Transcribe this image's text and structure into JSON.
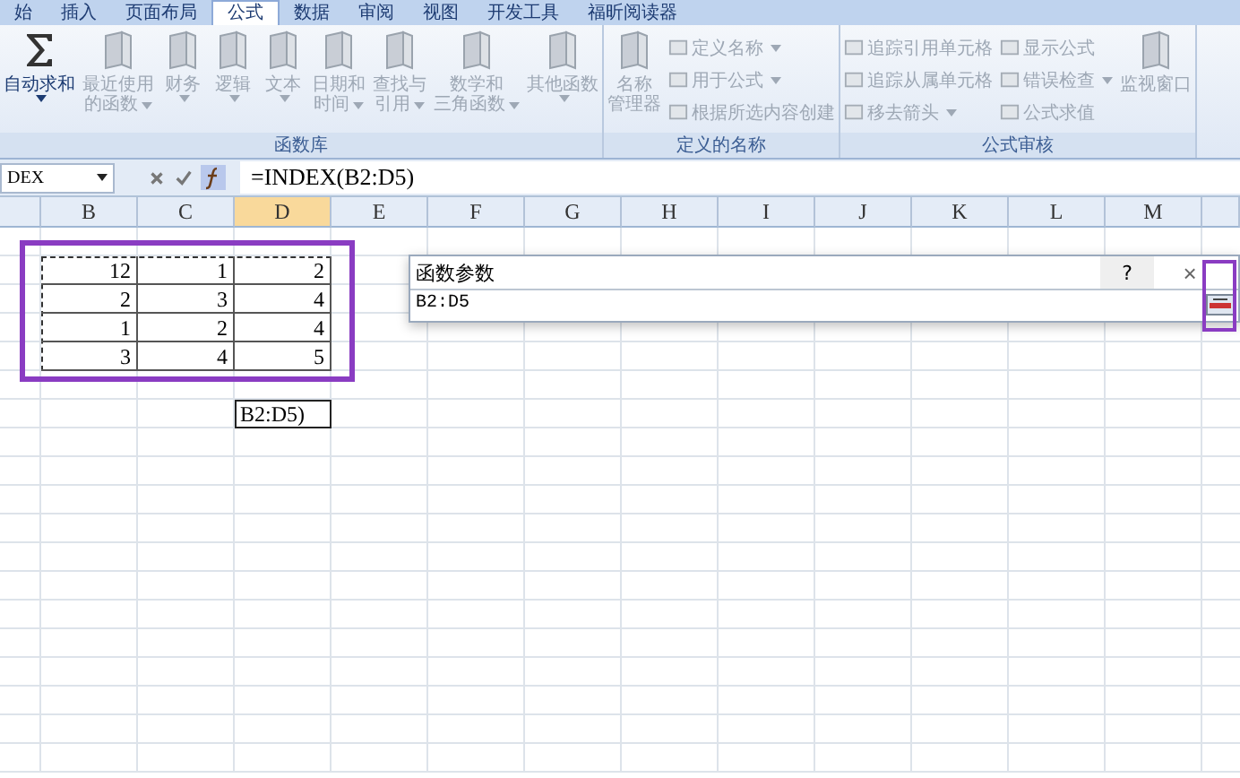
{
  "tabs": [
    {
      "label": "始",
      "selected": false
    },
    {
      "label": "插入",
      "selected": false
    },
    {
      "label": "页面布局",
      "selected": false
    },
    {
      "label": "公式",
      "selected": true
    },
    {
      "label": "数据",
      "selected": false
    },
    {
      "label": "审阅",
      "selected": false
    },
    {
      "label": "视图",
      "selected": false
    },
    {
      "label": "开发工具",
      "selected": false
    },
    {
      "label": "福昕阅读器",
      "selected": false
    }
  ],
  "ribbon_groups": [
    {
      "label": "函数库",
      "items": [
        {
          "kind": "sum",
          "lines": [
            "自动求和"
          ],
          "dropdown": true,
          "disabled": false
        },
        {
          "kind": "large",
          "lines": [
            "最近使用",
            "的函数"
          ],
          "dropdown": true,
          "disabled": true
        },
        {
          "kind": "large",
          "lines": [
            "财务"
          ],
          "dropdown": true,
          "disabled": true
        },
        {
          "kind": "large",
          "lines": [
            "逻辑"
          ],
          "dropdown": true,
          "disabled": true
        },
        {
          "kind": "large",
          "lines": [
            "文本"
          ],
          "dropdown": true,
          "disabled": true
        },
        {
          "kind": "large",
          "lines": [
            "日期和",
            "时间"
          ],
          "dropdown": true,
          "disabled": true
        },
        {
          "kind": "large",
          "lines": [
            "查找与",
            "引用"
          ],
          "dropdown": true,
          "disabled": true
        },
        {
          "kind": "large",
          "lines": [
            "数学和",
            "三角函数"
          ],
          "dropdown": true,
          "disabled": true
        },
        {
          "kind": "large",
          "lines": [
            "其他函数"
          ],
          "dropdown": true,
          "disabled": true
        }
      ]
    },
    {
      "label": "定义的名称",
      "items": [
        {
          "kind": "large",
          "lines": [
            "名称",
            "管理器"
          ],
          "dropdown": false,
          "disabled": true
        },
        {
          "kind": "stack",
          "items": [
            {
              "label": "定义名称",
              "dropdown": true,
              "disabled": true
            },
            {
              "label": "用于公式",
              "dropdown": true,
              "disabled": true
            },
            {
              "label": "根据所选内容创建",
              "dropdown": false,
              "disabled": true
            }
          ]
        }
      ]
    },
    {
      "label": "公式审核",
      "items": [
        {
          "kind": "stack",
          "items": [
            {
              "label": "追踪引用单元格",
              "dropdown": false,
              "disabled": true
            },
            {
              "label": "追踪从属单元格",
              "dropdown": false,
              "disabled": true
            },
            {
              "label": "移去箭头",
              "dropdown": true,
              "disabled": true
            }
          ]
        },
        {
          "kind": "stack",
          "items": [
            {
              "label": "显示公式",
              "dropdown": false,
              "disabled": true
            },
            {
              "label": "错误检查",
              "dropdown": true,
              "disabled": true
            },
            {
              "label": "公式求值",
              "dropdown": false,
              "disabled": true
            }
          ]
        },
        {
          "kind": "large",
          "lines": [
            "监视窗口"
          ],
          "dropdown": false,
          "disabled": true
        }
      ]
    }
  ],
  "formula_bar": {
    "name_box": "DEX",
    "formula": "=INDEX(B2:D5)"
  },
  "sheet": {
    "columns": [
      {
        "label": "B",
        "selected": false
      },
      {
        "label": "C",
        "selected": false
      },
      {
        "label": "D",
        "selected": true
      },
      {
        "label": "E",
        "selected": false
      },
      {
        "label": "F",
        "selected": false
      },
      {
        "label": "G",
        "selected": false
      },
      {
        "label": "H",
        "selected": false
      },
      {
        "label": "I",
        "selected": false
      },
      {
        "label": "J",
        "selected": false
      },
      {
        "label": "K",
        "selected": false
      },
      {
        "label": "L",
        "selected": false
      },
      {
        "label": "M",
        "selected": false
      }
    ],
    "range_rows": [
      [
        "12",
        "1",
        "2"
      ],
      [
        "2",
        "3",
        "4"
      ],
      [
        "1",
        "2",
        "4"
      ],
      [
        "3",
        "4",
        "5"
      ]
    ],
    "edit_cell": "B2:D5)"
  },
  "dialog": {
    "title": "函数参数",
    "help": "?",
    "close": "×",
    "value": "B2:D5"
  }
}
